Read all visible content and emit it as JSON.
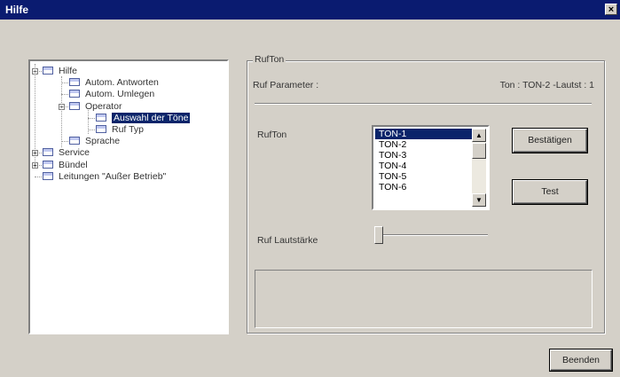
{
  "window": {
    "title": "Hilfe",
    "close_glyph": "×"
  },
  "tree": {
    "items": [
      {
        "label": "Hilfe",
        "level": 0,
        "expander": "−"
      },
      {
        "label": "Autom. Antworten",
        "level": 1
      },
      {
        "label": "Autom. Umlegen",
        "level": 1
      },
      {
        "label": "Operator",
        "level": 1,
        "expander": "−"
      },
      {
        "label": "Auswahl der Töne",
        "level": 2,
        "selected": true
      },
      {
        "label": "Ruf Typ",
        "level": 2
      },
      {
        "label": "Sprache",
        "level": 1
      },
      {
        "label": "Service",
        "level": 0,
        "expander": "+"
      },
      {
        "label": "Bündel",
        "level": 0,
        "expander": "+"
      },
      {
        "label": "Leitungen \"Außer Betrieb\"",
        "level": 0
      }
    ]
  },
  "group": {
    "title": "RufTon",
    "param_label": "Ruf Parameter :",
    "param_value": "Ton : TON-2 -Lautst : 1",
    "rufton_label": "RufTon",
    "volume_label": "Ruf Lautstärke",
    "volume_level": 0
  },
  "tones": {
    "items": [
      "TON-1",
      "TON-2",
      "TON-3",
      "TON-4",
      "TON-5",
      "TON-6"
    ],
    "selected_index": 0
  },
  "buttons": {
    "confirm": "Bestätigen",
    "test": "Test",
    "close": "Beenden"
  },
  "icons": {
    "scroll_up": "▲",
    "scroll_down": "▼",
    "tree_node": "tree-node-icon"
  }
}
